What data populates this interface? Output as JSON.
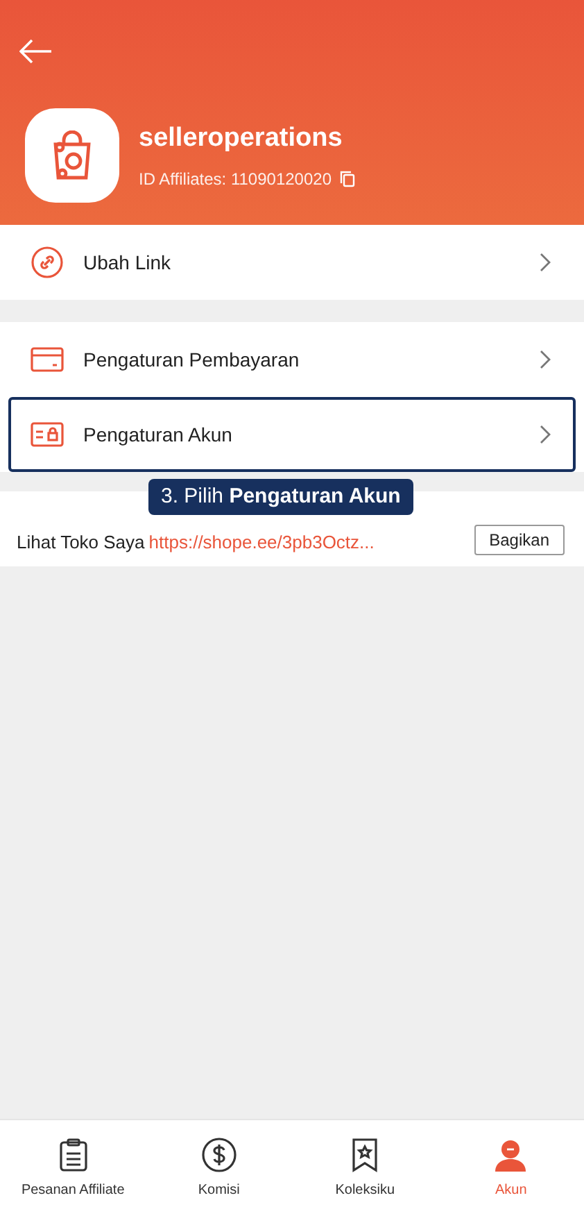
{
  "profile": {
    "name": "selleroperations",
    "affiliate_id": "ID Affiliates: 11090120020"
  },
  "menu_groups": [
    {
      "items": [
        {
          "kind": "link",
          "label": "Ubah Link",
          "highlighted": false
        }
      ]
    },
    {
      "items": [
        {
          "kind": "card",
          "label": "Pengaturan Pembayaran",
          "highlighted": false
        },
        {
          "kind": "account",
          "label": "Pengaturan Akun",
          "highlighted": true
        }
      ]
    }
  ],
  "shop_row": {
    "label": "Lihat Toko Saya",
    "url": "https://shope.ee/3pb3Octz...",
    "button": "Bagikan"
  },
  "tooltip": "3. Pilih **Pengaturan Akun**",
  "tabs": [
    {
      "kind": "orders",
      "label": "Pesanan Affiliate",
      "selected": false
    },
    {
      "kind": "commission",
      "label": "Komisi",
      "selected": false
    },
    {
      "kind": "collection",
      "label": "Koleksiku",
      "selected": false
    },
    {
      "kind": "account",
      "label": "Akun",
      "selected": true
    }
  ]
}
